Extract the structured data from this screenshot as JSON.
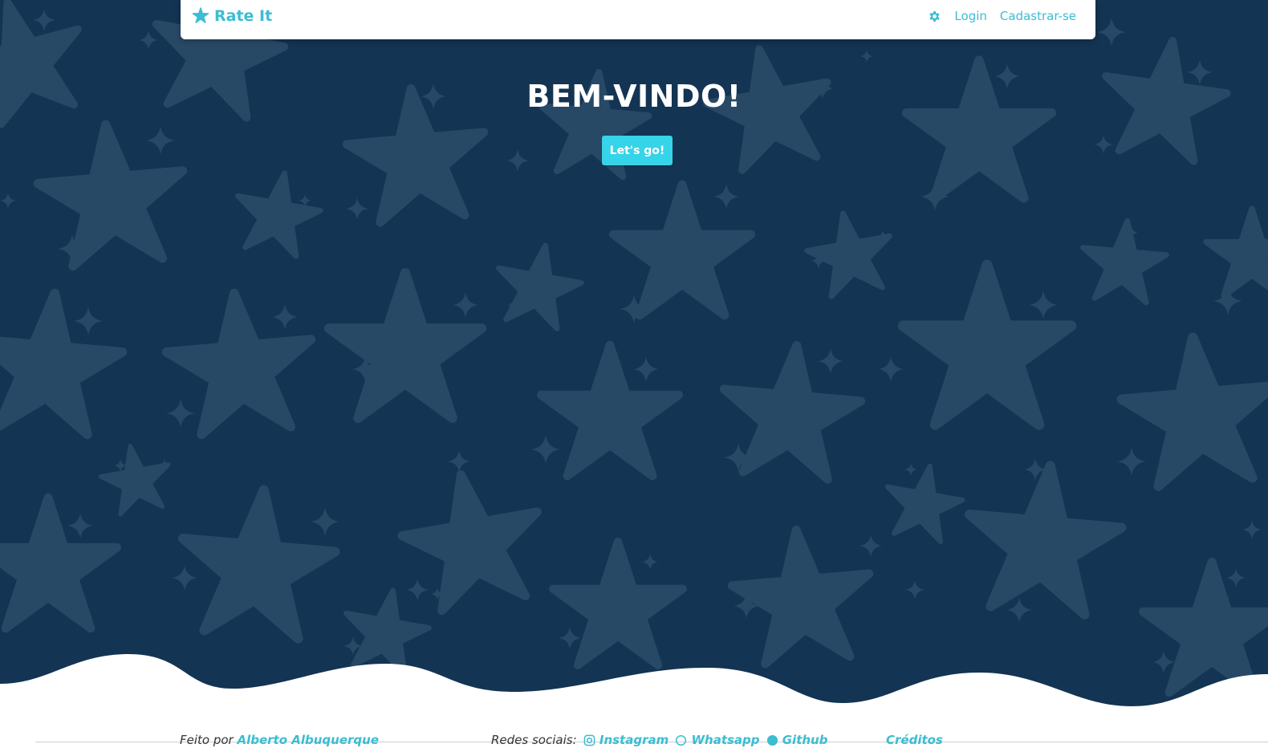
{
  "navbar": {
    "brand": "Rate It",
    "login": "Login",
    "signup": "Cadastrar-se",
    "settings_icon": "gear-icon",
    "brand_icon": "star-icon"
  },
  "hero": {
    "title": "BEM-VINDO!",
    "cta": "Let's go!"
  },
  "footer": {
    "made_by_label": "Feito por",
    "made_by_name": "Alberto Albuquerque",
    "social_label": "Redes sociais:",
    "social_links": [
      "Instagram",
      "Whatsapp",
      "Github"
    ],
    "credits": "Créditos"
  },
  "colors": {
    "background": "#133453",
    "star": "#284966",
    "accent": "#3bbdd2",
    "button": "#35d4e8"
  }
}
